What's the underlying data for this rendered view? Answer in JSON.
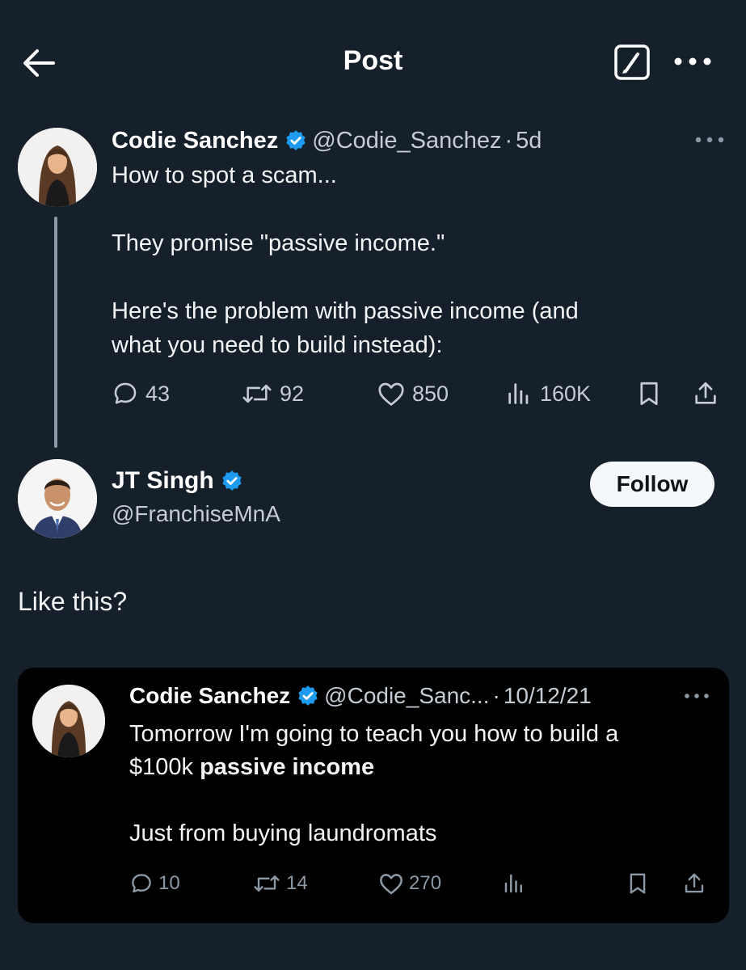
{
  "header": {
    "title": "Post",
    "back_icon": "arrow-left-icon",
    "compose_icon": "compose-icon",
    "more_icon": "more-horizontal-icon"
  },
  "main_post": {
    "author_name": "Codie Sanchez",
    "handle": "@Codie_Sanchez",
    "separator": "·",
    "time": "5d",
    "text_lines": [
      "How to spot a scam...",
      "",
      "They promise \"passive income.\"",
      "",
      "Here's the problem with passive income (and",
      "what you need to build instead):"
    ],
    "actions": {
      "replies": "43",
      "reposts": "92",
      "likes": "850",
      "views": "160K"
    }
  },
  "reply_post": {
    "author_name": "JT Singh",
    "handle": "@FranchiseMnA",
    "follow_label": "Follow",
    "text": "Like this?"
  },
  "quoted_post": {
    "author_name": "Codie Sanchez",
    "handle": "@Codie_Sanc...",
    "separator": "·",
    "time": "10/12/21",
    "line1": "Tomorrow I'm going to teach you how to build a",
    "line2_prefix": "$100k ",
    "line2_bold": "passive income",
    "line3": "",
    "line4": "Just from buying laundromats",
    "actions": {
      "replies": "10",
      "reposts": "14",
      "likes": "270"
    }
  },
  "colors": {
    "background": "#15202b",
    "verified_blue": "#1d9bf0",
    "secondary_text": "#c5ccd3",
    "quote_background": "#000000"
  }
}
